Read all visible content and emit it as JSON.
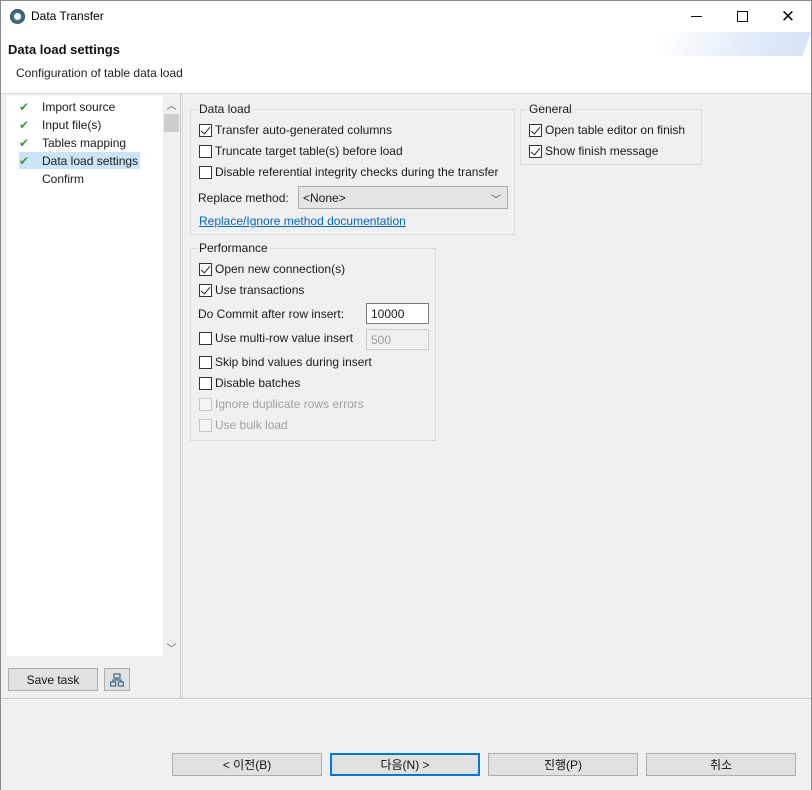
{
  "window": {
    "title": "Data Transfer",
    "controls": [
      "minimize",
      "maximize",
      "close"
    ]
  },
  "header": {
    "title": "Data load settings",
    "subtitle": "Configuration of table data load"
  },
  "sidebar": {
    "items": [
      {
        "label": "Import source",
        "done": true
      },
      {
        "label": "Input file(s)",
        "done": true
      },
      {
        "label": "Tables mapping",
        "done": true
      },
      {
        "label": "Data load settings",
        "done": true,
        "selected": true
      },
      {
        "label": "Confirm",
        "done": false
      }
    ],
    "save_task_label": "Save task",
    "tool_icon": "hierarchy-icon"
  },
  "data_load": {
    "legend": "Data load",
    "transfer_auto_generated": {
      "label": "Transfer auto-generated columns",
      "checked": true
    },
    "truncate_target": {
      "label": "Truncate target table(s) before load",
      "checked": false
    },
    "disable_ref_integrity": {
      "label": "Disable referential integrity checks during the transfer",
      "checked": false
    },
    "replace_method_label": "Replace method:",
    "replace_method_value": "<None>",
    "doc_link": "Replace/Ignore method documentation"
  },
  "general": {
    "legend": "General",
    "open_table_editor": {
      "label": "Open table editor on finish",
      "checked": true
    },
    "show_finish_message": {
      "label": "Show finish message",
      "checked": true
    }
  },
  "performance": {
    "legend": "Performance",
    "open_new_connections": {
      "label": "Open new connection(s)",
      "checked": true
    },
    "use_transactions": {
      "label": "Use transactions",
      "checked": true
    },
    "commit_label": "Do Commit after row insert:",
    "commit_value": "10000",
    "multi_row": {
      "label": "Use multi-row value insert",
      "checked": false
    },
    "multi_row_value": "500",
    "skip_bind": {
      "label": "Skip bind values during insert",
      "checked": false
    },
    "disable_batches": {
      "label": "Disable batches",
      "checked": false
    },
    "ignore_duplicates": {
      "label": "Ignore duplicate rows errors",
      "checked": false,
      "enabled": false
    },
    "use_bulk_load": {
      "label": "Use bulk load",
      "checked": false,
      "enabled": false
    }
  },
  "footer": {
    "back": "< 이전(B)",
    "next": "다음(N) >",
    "proceed": "진행(P)",
    "cancel": "취소"
  },
  "colors": {
    "accent": "#0078d7",
    "link": "#0066cc",
    "check_green": "#3a9a3a",
    "selection": "#cce4f7"
  }
}
